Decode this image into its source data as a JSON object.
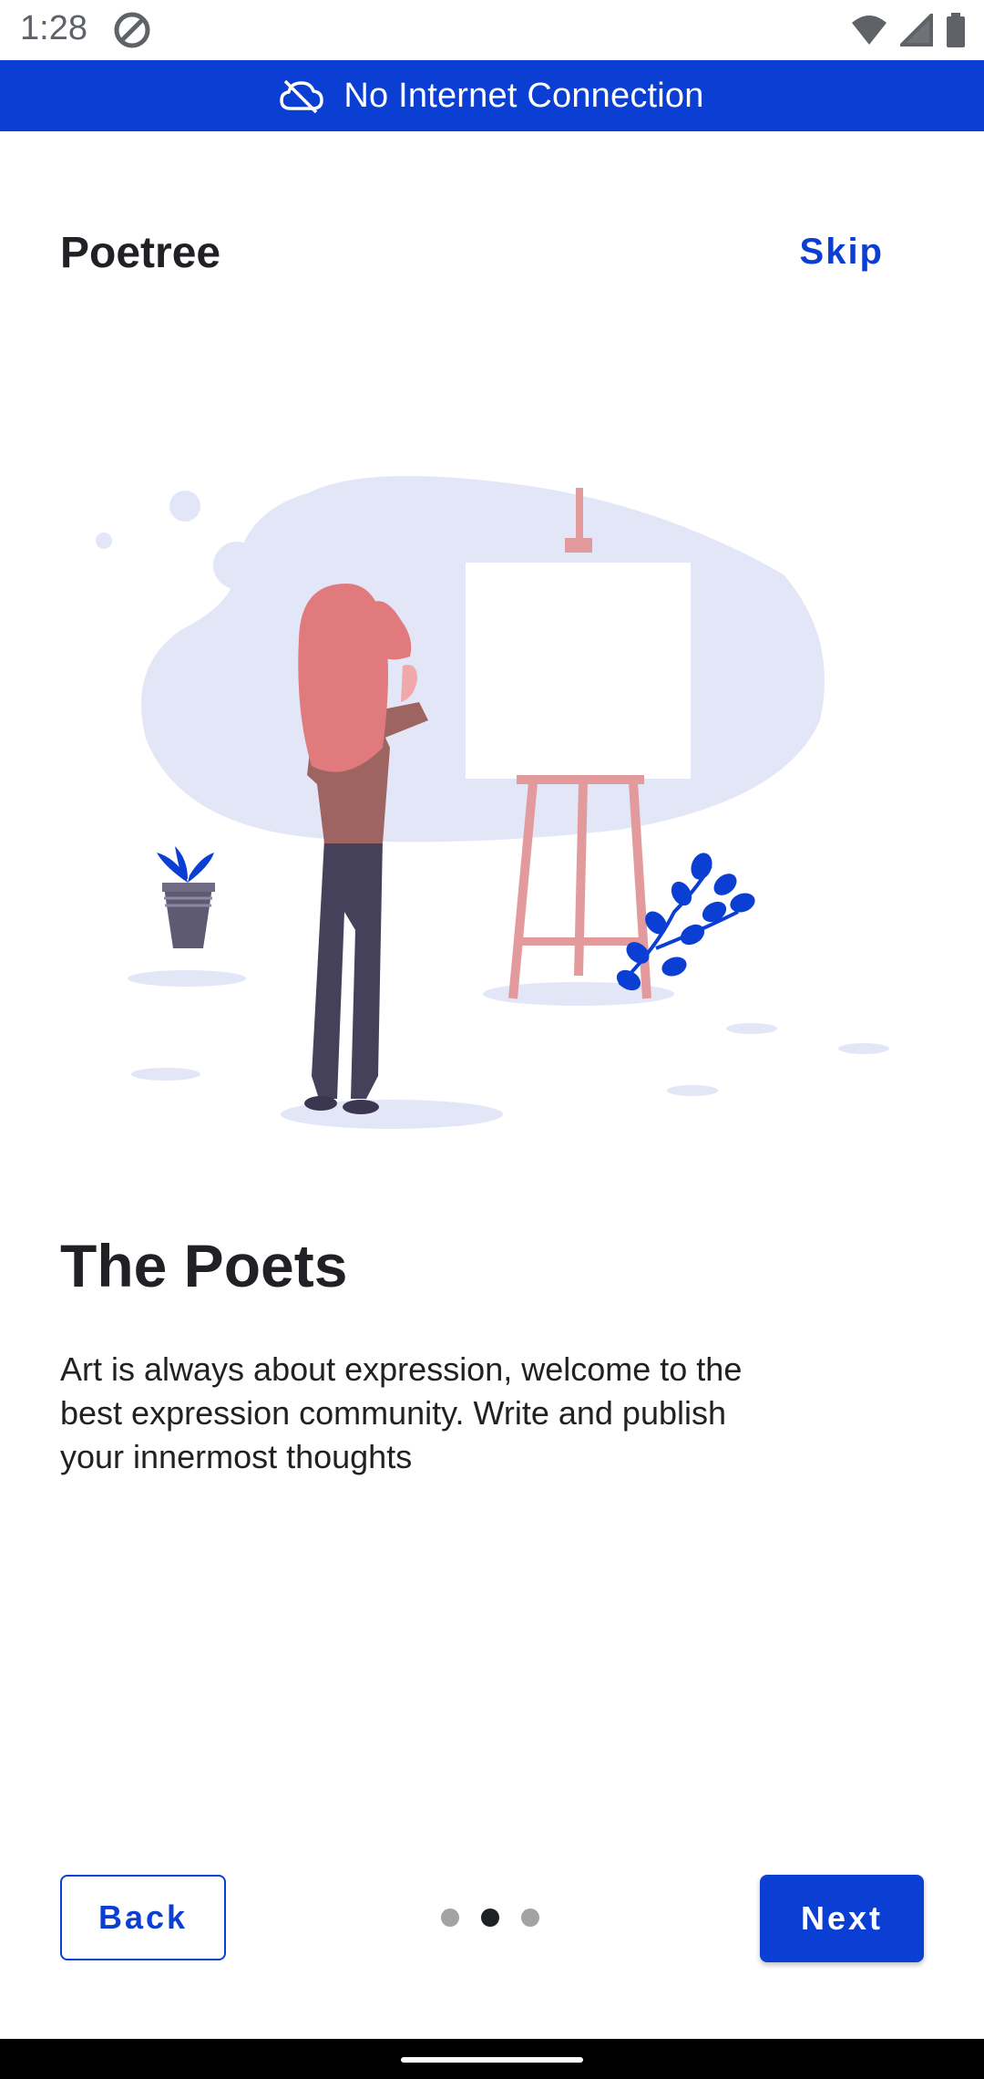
{
  "status_bar": {
    "time": "1:28",
    "icons": [
      "at-sign-icon",
      "wifi-icon",
      "cellular-icon",
      "battery-icon"
    ]
  },
  "banner": {
    "text": "No Internet Connection",
    "icon": "cloud-off-icon",
    "background": "#0b3fd3"
  },
  "header": {
    "app_title": "Poetree",
    "skip_label": "Skip"
  },
  "content": {
    "heading": "The Poets",
    "body": "Art is always about expression, welcome to the best expression community. Write and publish your innermost thoughts",
    "illustration": "woman-painting-easel-illustration"
  },
  "footer": {
    "back_label": "Back",
    "next_label": "Next",
    "page_count": 3,
    "active_page": 2
  },
  "colors": {
    "accent": "#0b3fd3",
    "text": "#202124"
  }
}
